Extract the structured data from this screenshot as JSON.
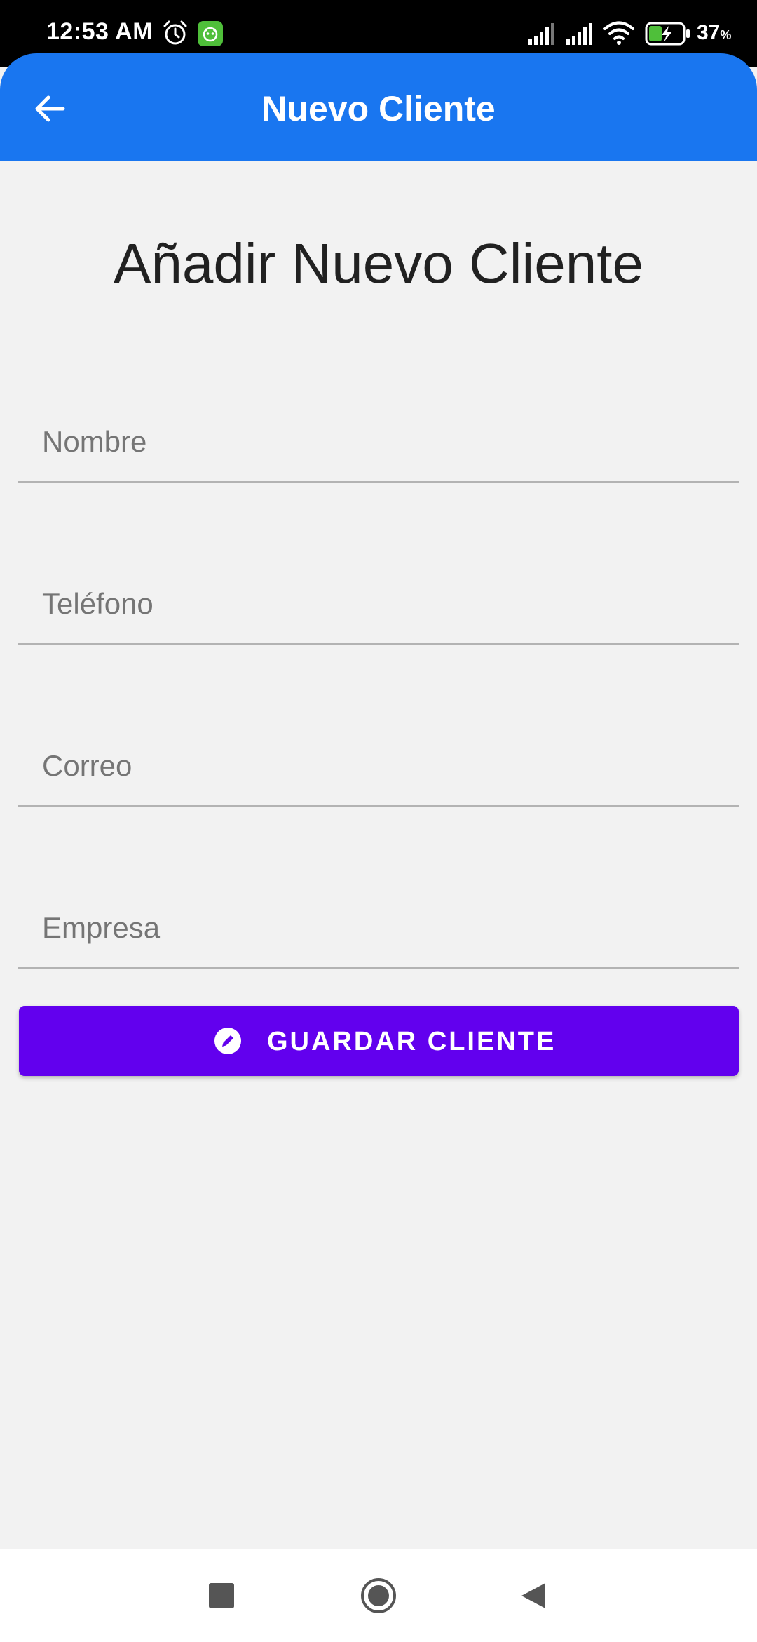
{
  "status_bar": {
    "time": "12:53 AM",
    "battery_value": "37",
    "battery_unit": "%",
    "icons": [
      "alarm-icon",
      "app-notification-icon",
      "signal-icon",
      "signal-icon",
      "wifi-icon",
      "battery-charging-icon"
    ]
  },
  "app_bar": {
    "title": "Nuevo Cliente",
    "back_icon": "arrow-back-icon",
    "color": "#1976f0"
  },
  "form": {
    "heading": "Añadir Nuevo Cliente",
    "fields": [
      {
        "placeholder": "Nombre",
        "value": ""
      },
      {
        "placeholder": "Teléfono",
        "value": ""
      },
      {
        "placeholder": "Correo",
        "value": ""
      },
      {
        "placeholder": "Empresa",
        "value": ""
      }
    ],
    "save_button": {
      "label": "GUARDAR CLIENTE",
      "icon": "edit-icon",
      "color": "#6200ee"
    }
  },
  "nav_bar": {
    "icons": [
      "recents-icon",
      "home-icon",
      "back-icon"
    ]
  }
}
